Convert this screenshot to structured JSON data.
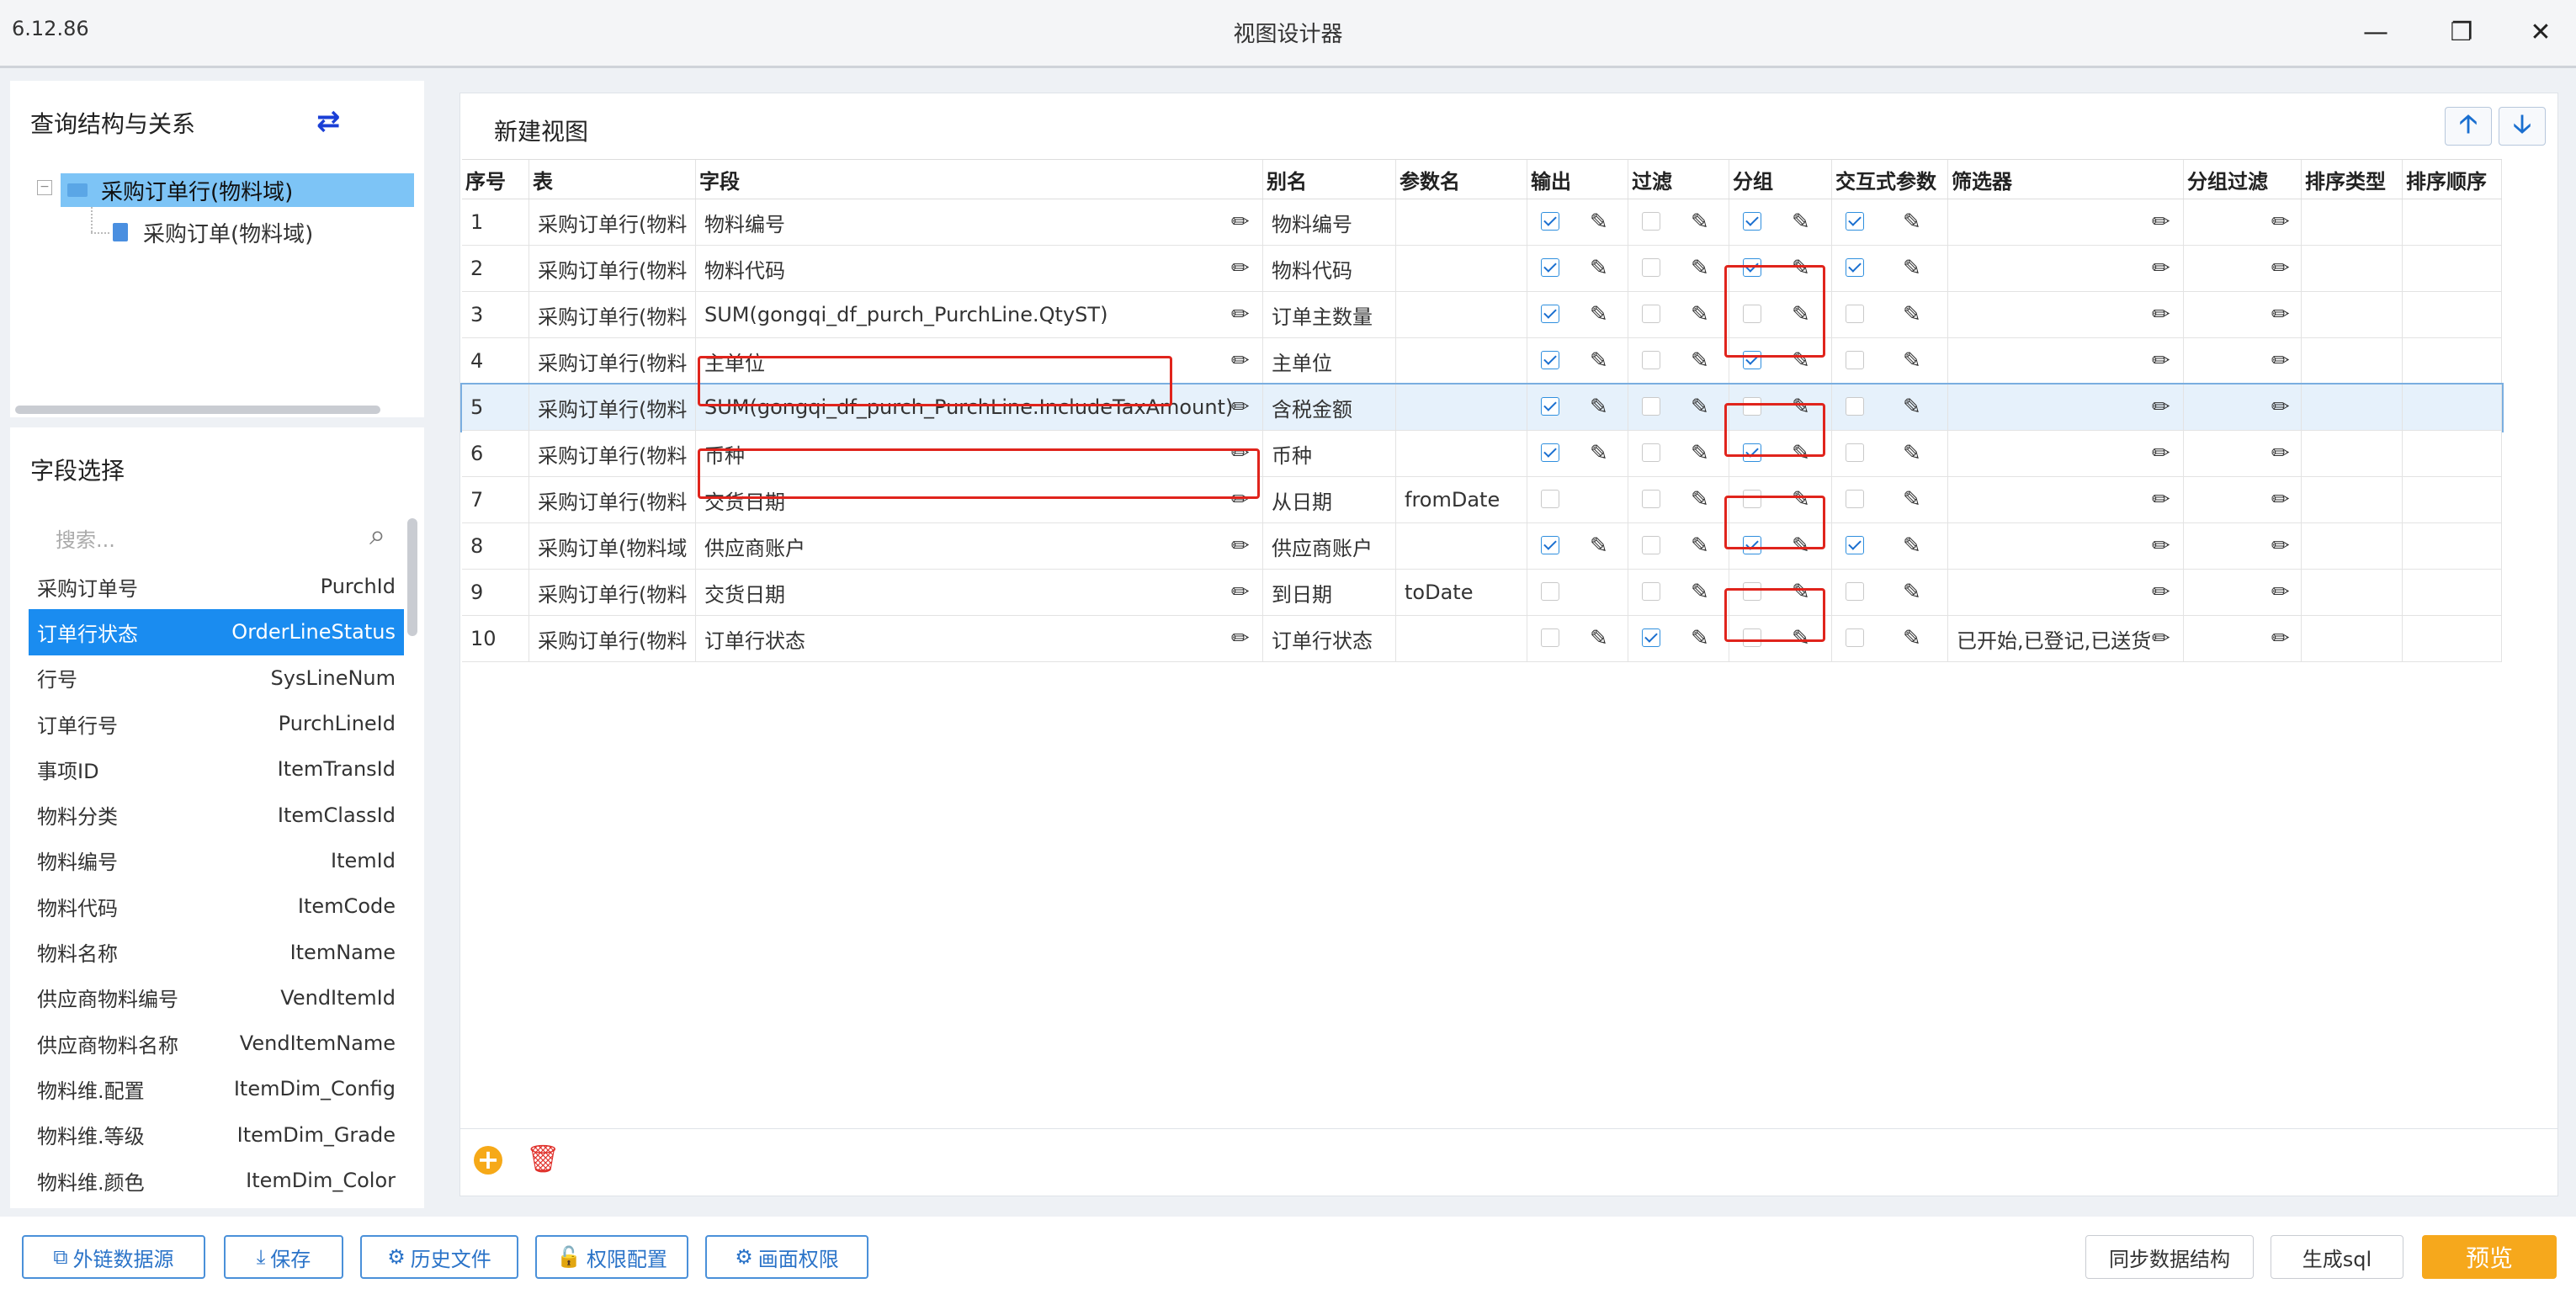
{
  "window": {
    "version": "6.12.86",
    "title": "视图设计器"
  },
  "query_panel": {
    "title": "查询结构与关系",
    "tree_root": "采购订单行(物料域)",
    "tree_child": "采购订单(物料域)"
  },
  "field_panel": {
    "title": "字段选择",
    "search_placeholder": "搜索...",
    "items": [
      {
        "label": "采购订单号",
        "code": "PurchId"
      },
      {
        "label": "订单行状态",
        "code": "OrderLineStatus"
      },
      {
        "label": "行号",
        "code": "SysLineNum"
      },
      {
        "label": "订单行号",
        "code": "PurchLineId"
      },
      {
        "label": "事项ID",
        "code": "ItemTransId"
      },
      {
        "label": "物料分类",
        "code": "ItemClassId"
      },
      {
        "label": "物料编号",
        "code": "ItemId"
      },
      {
        "label": "物料代码",
        "code": "ItemCode"
      },
      {
        "label": "物料名称",
        "code": "ItemName"
      },
      {
        "label": "供应商物料编号",
        "code": "VendItemId"
      },
      {
        "label": "供应商物料名称",
        "code": "VendItemName"
      },
      {
        "label": "物料维.配置",
        "code": "ItemDim_Config"
      },
      {
        "label": "物料维.等级",
        "code": "ItemDim_Grade"
      },
      {
        "label": "物料维.颜色",
        "code": "ItemDim_Color"
      }
    ]
  },
  "main": {
    "title": "新建视图",
    "headers": {
      "seq": "序号",
      "table": "表",
      "field": "字段",
      "alias": "别名",
      "param": "参数名",
      "output": "输出",
      "filter": "过滤",
      "group": "分组",
      "interactive": "交互式参数",
      "selector": "筛选器",
      "group_filter": "分组过滤",
      "sort_type": "排序类型",
      "sort_order": "排序顺序"
    },
    "rows": [
      {
        "seq": "1",
        "table": "采购订单行(物料",
        "field": "物料编号",
        "alias": "物料编号",
        "param": "",
        "output": true,
        "filter": false,
        "group": true,
        "interactive": true,
        "selector": ""
      },
      {
        "seq": "2",
        "table": "采购订单行(物料",
        "field": "物料代码",
        "alias": "物料代码",
        "param": "",
        "output": true,
        "filter": false,
        "group": true,
        "interactive": true,
        "selector": ""
      },
      {
        "seq": "3",
        "table": "采购订单行(物料",
        "field": "SUM(gongqi_df_purch_PurchLine.QtyST)",
        "alias": "订单主数量",
        "param": "",
        "output": true,
        "filter": false,
        "group": false,
        "interactive": false,
        "selector": ""
      },
      {
        "seq": "4",
        "table": "采购订单行(物料",
        "field": "主单位",
        "alias": "主单位",
        "param": "",
        "output": true,
        "filter": false,
        "group": true,
        "interactive": false,
        "selector": ""
      },
      {
        "seq": "5",
        "table": "采购订单行(物料",
        "field": "SUM(gongqi_df_purch_PurchLine.IncludeTaxAmount)",
        "alias": "含税金额",
        "param": "",
        "output": true,
        "filter": false,
        "group": false,
        "interactive": false,
        "selector": ""
      },
      {
        "seq": "6",
        "table": "采购订单行(物料",
        "field": "币种",
        "alias": "币种",
        "param": "",
        "output": true,
        "filter": false,
        "group": true,
        "interactive": false,
        "selector": ""
      },
      {
        "seq": "7",
        "table": "采购订单行(物料",
        "field": "交货日期",
        "alias": "从日期",
        "param": "fromDate",
        "output": false,
        "filter": false,
        "group": false,
        "interactive": false,
        "selector": ""
      },
      {
        "seq": "8",
        "table": "采购订单(物料域",
        "field": "供应商账户",
        "alias": "供应商账户",
        "param": "",
        "output": true,
        "filter": false,
        "group": true,
        "interactive": true,
        "selector": ""
      },
      {
        "seq": "9",
        "table": "采购订单行(物料",
        "field": "交货日期",
        "alias": "到日期",
        "param": "toDate",
        "output": false,
        "filter": false,
        "group": false,
        "interactive": false,
        "selector": ""
      },
      {
        "seq": "10",
        "table": "采购订单行(物料",
        "field": "订单行状态",
        "alias": "订单行状态",
        "param": "",
        "output": false,
        "filter": true,
        "group": false,
        "interactive": false,
        "selector": "已开始,已登记,已送货"
      }
    ]
  },
  "toolbar": {
    "external_source": "外链数据源",
    "save": "保存",
    "history": "历史文件",
    "permission": "权限配置",
    "screen_permission": "画面权限",
    "sync": "同步数据结构",
    "generate_sql": "生成sql",
    "preview": "预览"
  },
  "colors": {
    "accent": "#1a8cf0",
    "preview": "#f6a81c",
    "highlight": "#e0241c"
  }
}
